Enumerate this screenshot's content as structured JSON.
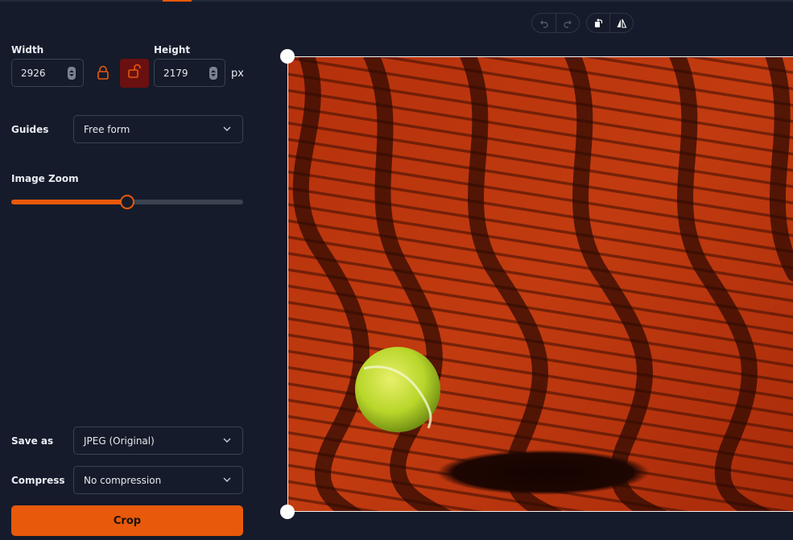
{
  "dimensions": {
    "width_label": "Width",
    "width_value": "2926",
    "height_label": "Height",
    "height_value": "2179",
    "unit": "px",
    "lock_icon": "lock-icon",
    "unlock_icon": "unlock-icon"
  },
  "guides": {
    "label": "Guides",
    "value": "Free form"
  },
  "zoom": {
    "label": "Image Zoom",
    "level": 0.5
  },
  "save_as": {
    "label": "Save as",
    "value": "JPEG (Original)"
  },
  "compress": {
    "label": "Compress",
    "value": "No compression"
  },
  "crop_button": "Crop",
  "toolbar": {
    "icons": [
      "undo-icon",
      "redo-icon",
      "rotate-icon",
      "flip-icon"
    ]
  },
  "colors": {
    "accent": "#e8590c",
    "background": "#151b2a",
    "unlock_active": "#6b1010"
  }
}
